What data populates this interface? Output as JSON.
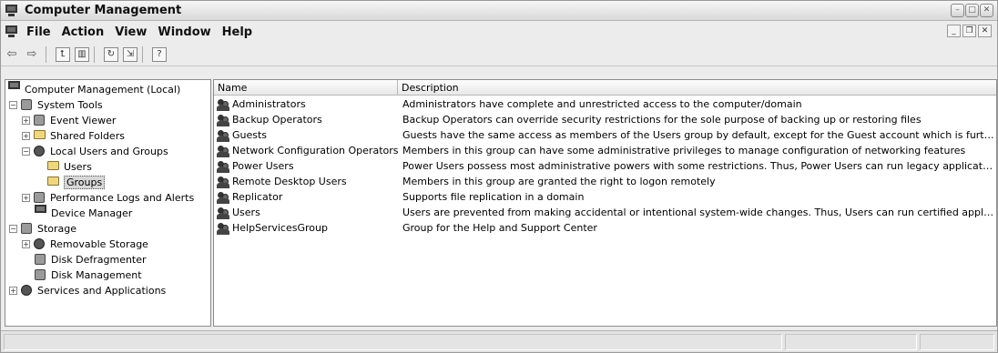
{
  "window": {
    "title": "Computer Management"
  },
  "menubar": {
    "items": [
      "File",
      "Action",
      "View",
      "Window",
      "Help"
    ]
  },
  "toolbar": {
    "buttons": [
      "back-arrow-icon",
      "forward-arrow-icon",
      "up-level-icon",
      "show-hide-tree-icon",
      "refresh-icon",
      "export-list-icon",
      "help-icon"
    ]
  },
  "tree": {
    "root": "Computer Management (Local)",
    "system_tools": "System Tools",
    "event_viewer": "Event Viewer",
    "shared_folders": "Shared Folders",
    "local_users_groups": "Local Users and Groups",
    "users": "Users",
    "groups": "Groups",
    "perf_logs": "Performance Logs and Alerts",
    "device_manager": "Device Manager",
    "storage": "Storage",
    "removable_storage": "Removable Storage",
    "disk_defrag": "Disk Defragmenter",
    "disk_management": "Disk Management",
    "services_apps": "Services and Applications"
  },
  "list": {
    "columns": [
      "Name",
      "Description"
    ],
    "rows": [
      {
        "name": "Administrators",
        "description": "Administrators have complete and unrestricted access to the computer/domain"
      },
      {
        "name": "Backup Operators",
        "description": "Backup Operators can override security restrictions for the sole purpose of backing up or restoring files"
      },
      {
        "name": "Guests",
        "description": "Guests have the same access as members of the Users group by default, except for the Guest account which is further re..."
      },
      {
        "name": "Network Configuration Operators",
        "description": "Members in this group can have some administrative privileges to manage configuration of networking features"
      },
      {
        "name": "Power Users",
        "description": "Power Users possess most administrative powers with some restrictions.  Thus, Power Users can run legacy applications in..."
      },
      {
        "name": "Remote Desktop Users",
        "description": "Members in this group are granted the right to logon remotely"
      },
      {
        "name": "Replicator",
        "description": "Supports file replication in a domain"
      },
      {
        "name": "Users",
        "description": "Users are prevented from making accidental or intentional system-wide changes.  Thus, Users can run certified application..."
      },
      {
        "name": "HelpServicesGroup",
        "description": "Group for the Help and Support Center"
      }
    ]
  }
}
